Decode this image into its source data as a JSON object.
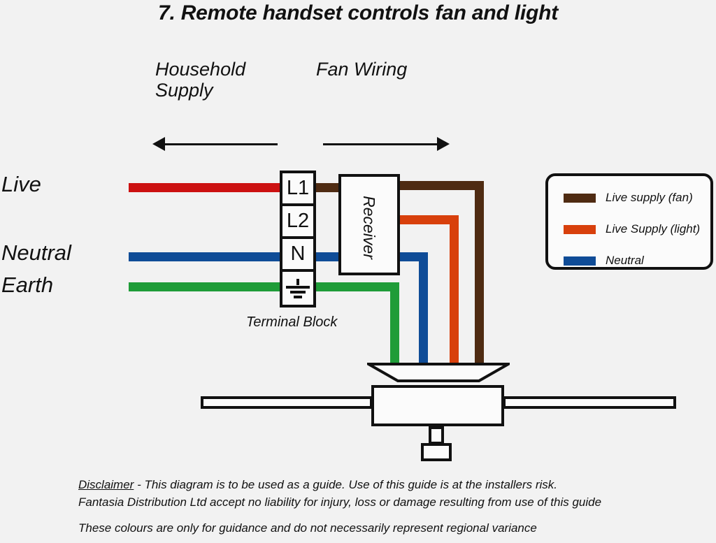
{
  "title": "7. Remote handset controls fan and light",
  "sections": {
    "household": "Household\nSupply",
    "fan_wiring": "Fan Wiring"
  },
  "supply_labels": {
    "live": "Live",
    "neutral": "Neutral",
    "earth": "Earth"
  },
  "terminal_block": {
    "caption": "Terminal Block",
    "cells": [
      "L1",
      "L2",
      "N",
      "earth-symbol"
    ]
  },
  "receiver": {
    "label": "Receiver"
  },
  "legend": {
    "items": [
      {
        "label": "Live supply (fan)",
        "color": "#4f2b12"
      },
      {
        "label": "Live Supply (light)",
        "color": "#d8400c"
      },
      {
        "label": "Neutral",
        "color": "#0f4c97"
      }
    ]
  },
  "colors": {
    "background": "#f2f2f2",
    "outline": "#111111",
    "red_live": "#cc1111",
    "blue_neutral": "#0f4c97",
    "green_earth": "#1f9c38",
    "brown_live_fan": "#4f2b12",
    "orange_live_light": "#d8400c"
  },
  "disclaimer": {
    "heading": "Disclaimer",
    "line1": " - This diagram is to be used as a guide.  Use of this guide is at the installers risk.",
    "line2": "Fantasia Distribution Ltd accept no liability for injury, loss or damage resulting from use of this guide",
    "line3": "These colours are only for guidance and do not necessarily represent regional variance"
  }
}
